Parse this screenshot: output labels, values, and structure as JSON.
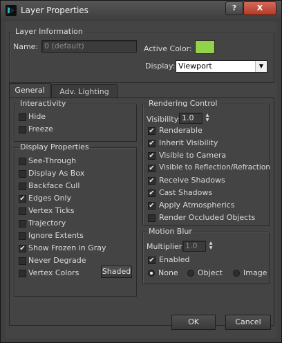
{
  "window": {
    "title": "Layer Properties",
    "help": "?",
    "close": "X"
  },
  "layer_info": {
    "title": "Layer Information",
    "name_label": "Name:",
    "name_value": "0 (default)",
    "active_color_label": "Active Color:",
    "active_color": "#93d34a",
    "display_label": "Display:",
    "display_value": "Viewport"
  },
  "tabs": [
    {
      "label": "General",
      "active": true
    },
    {
      "label": "Adv. Lighting",
      "active": false
    }
  ],
  "interactivity": {
    "title": "Interactivity",
    "items": [
      {
        "label": "Hide",
        "checked": false
      },
      {
        "label": "Freeze",
        "checked": false
      }
    ]
  },
  "display_properties": {
    "title": "Display Properties",
    "items": [
      {
        "label": "See-Through",
        "checked": false
      },
      {
        "label": "Display As Box",
        "checked": false
      },
      {
        "label": "Backface Cull",
        "checked": false
      },
      {
        "label": "Edges Only",
        "checked": true
      },
      {
        "label": "Vertex Ticks",
        "checked": false
      },
      {
        "label": "Trajectory",
        "checked": false
      },
      {
        "label": "Ignore Extents",
        "checked": false
      },
      {
        "label": "Show Frozen in Gray",
        "checked": true
      },
      {
        "label": "Never Degrade",
        "checked": false
      },
      {
        "label": "Vertex Colors",
        "checked": false
      }
    ],
    "shaded_button": "Shaded"
  },
  "rendering_control": {
    "title": "Rendering Control",
    "visibility_label": "Visibility:",
    "visibility_value": "1.0",
    "items": [
      {
        "label": "Renderable",
        "checked": true
      },
      {
        "label": "Inherit Visibility",
        "checked": true
      },
      {
        "label": "Visible to Camera",
        "checked": true
      },
      {
        "label": "Visible to Reflection/Refraction",
        "checked": true
      },
      {
        "label": "Receive Shadows",
        "checked": true
      },
      {
        "label": "Cast Shadows",
        "checked": true
      },
      {
        "label": "Apply Atmospherics",
        "checked": true
      },
      {
        "label": "Render Occluded Objects",
        "checked": false
      }
    ]
  },
  "motion_blur": {
    "title": "Motion Blur",
    "multiplier_label": "Multiplier:",
    "multiplier_value": "1.0",
    "enabled_label": "Enabled",
    "enabled_checked": true,
    "options": [
      {
        "label": "None",
        "selected": true
      },
      {
        "label": "Object",
        "selected": false
      },
      {
        "label": "Image",
        "selected": false
      }
    ]
  },
  "footer": {
    "ok": "OK",
    "cancel": "Cancel"
  }
}
